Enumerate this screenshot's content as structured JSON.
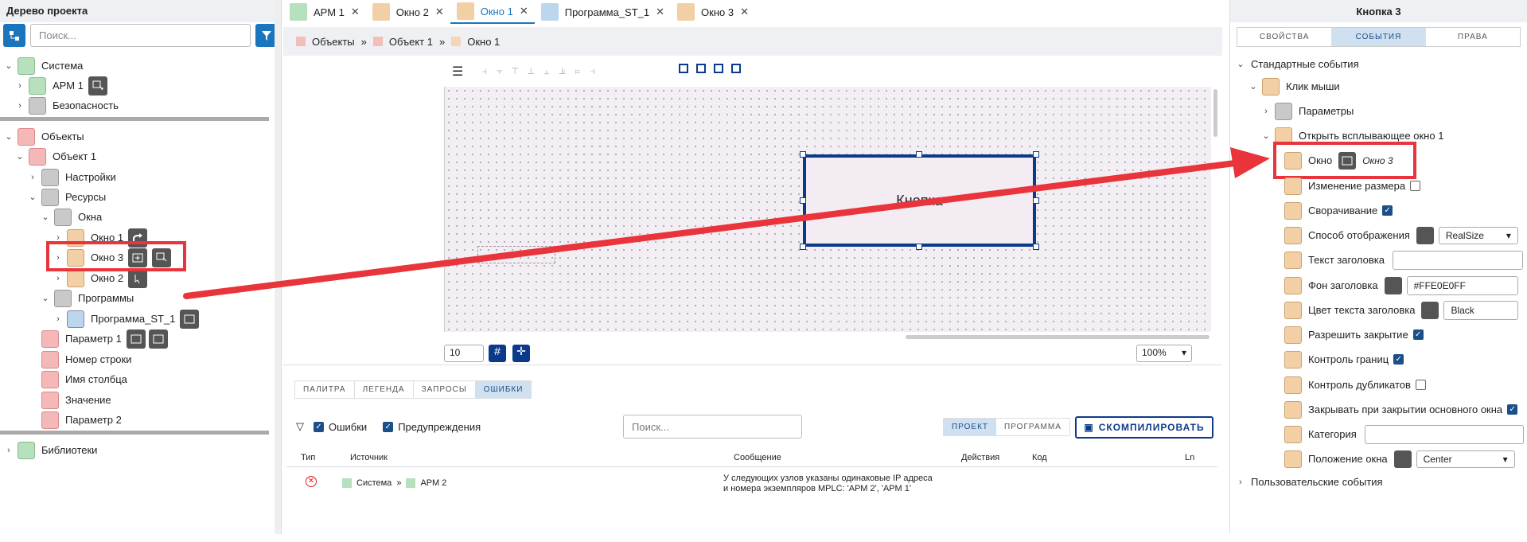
{
  "left": {
    "title": "Дерево проекта",
    "search_placeholder": "Поиск...",
    "items": [
      {
        "label": "Система"
      },
      {
        "label": "АРМ 1"
      },
      {
        "label": "Безопасность"
      },
      {
        "label": "Объекты"
      },
      {
        "label": "Объект 1"
      },
      {
        "label": "Настройки"
      },
      {
        "label": "Ресурсы"
      },
      {
        "label": "Окна"
      },
      {
        "label": "Окно 1"
      },
      {
        "label": "Окно 3"
      },
      {
        "label": "Окно 2"
      },
      {
        "label": "Программы"
      },
      {
        "label": "Программа_ST_1"
      },
      {
        "label": "Параметр 1"
      },
      {
        "label": "Номер строки"
      },
      {
        "label": "Имя столбца"
      },
      {
        "label": "Значение"
      },
      {
        "label": "Параметр 2"
      },
      {
        "label": "Библиотеки"
      }
    ]
  },
  "tabs": [
    {
      "label": "АРМ 1"
    },
    {
      "label": "Окно 2"
    },
    {
      "label": "Окно 1"
    },
    {
      "label": "Программа_ST_1"
    },
    {
      "label": "Окно 3"
    }
  ],
  "breadcrumb": [
    "Объекты",
    "Объект 1",
    "Окно 1"
  ],
  "canvas": {
    "button_text": "Кнопка",
    "grid_value": "10",
    "zoom": "100%"
  },
  "bottom": {
    "tabs": [
      "ПАЛИТРА",
      "ЛЕГЕНДА",
      "ЗАПРОСЫ",
      "ОШИБКИ"
    ],
    "filter_errors": "Ошибки",
    "filter_warnings": "Предупреждения",
    "search_placeholder": "Поиск...",
    "toggle": [
      "ПРОЕКТ",
      "ПРОГРАММА"
    ],
    "compile": "СКОМПИЛИРОВАТЬ",
    "columns": [
      "Тип",
      "Источник",
      "Сообщение",
      "Действия",
      "Код",
      "Ln"
    ],
    "row": {
      "source": [
        "Система",
        "АРМ 2"
      ],
      "message_l1": "У следующих узлов указаны одинаковые IP адреса",
      "message_l2": "и номера экземпляров MPLC: 'АРМ 2', 'АРМ 1'"
    }
  },
  "right": {
    "title": "Кнопка 3",
    "tabs": [
      "СВОЙСТВА",
      "СОБЫТИЯ",
      "ПРАВА"
    ],
    "std_events": "Стандартные события",
    "mouse_click": "Клик мыши",
    "params": "Параметры",
    "open_popup": "Открыть всплывающее окно 1",
    "window": "Окно",
    "window_value": "Окно 3",
    "resize": "Изменение размера",
    "minimize": "Сворачивание",
    "display_mode": "Способ отображения",
    "display_mode_val": "RealSize",
    "header_text": "Текст заголовка",
    "header_bg": "Фон заголовка",
    "header_bg_val": "#FFE0E0FF",
    "header_color": "Цвет текста заголовка",
    "header_color_val": "Black",
    "allow_close": "Разрешить закрытие",
    "bounds": "Контроль границ",
    "duplicates": "Контроль дубликатов",
    "close_with_main": "Закрывать при закрытии основного окна",
    "category": "Категория",
    "window_pos": "Положение окна",
    "window_pos_val": "Center",
    "user_events": "Пользовательские события"
  },
  "colors": {
    "accent": "#1b75bc",
    "highlight": "#e8343a",
    "selection": "#0c3a8a"
  }
}
